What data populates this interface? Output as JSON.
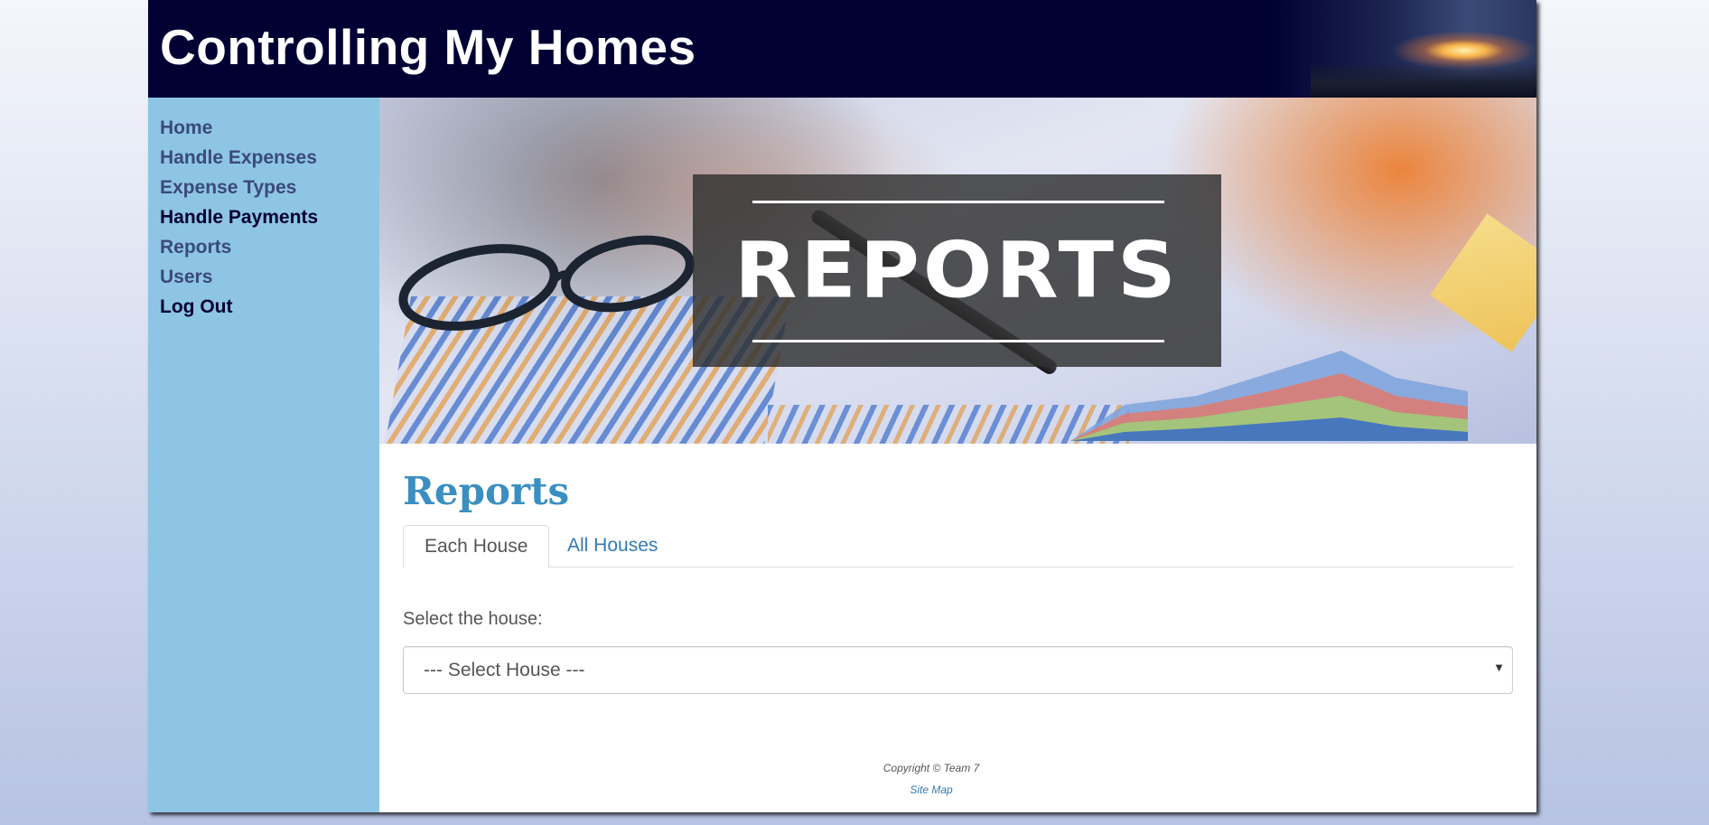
{
  "header": {
    "site_title": "Controlling My Homes"
  },
  "sidebar": {
    "items": [
      {
        "label": "Home"
      },
      {
        "label": "Handle Expenses"
      },
      {
        "label": "Expense Types"
      },
      {
        "label": "Handle Payments"
      },
      {
        "label": "Reports"
      },
      {
        "label": "Users"
      },
      {
        "label": "Log Out"
      }
    ]
  },
  "banner": {
    "text": "REPORTS"
  },
  "main": {
    "page_title": "Reports",
    "tabs": [
      {
        "label": "Each House",
        "active": true
      },
      {
        "label": "All Houses",
        "active": false
      }
    ],
    "select_label": "Select the house:",
    "select_value": "--- Select House ---"
  },
  "footer": {
    "copyright": "Copyright © Team 7",
    "sitemap": "Site Map"
  },
  "colors": {
    "header_bg": "#000033",
    "sidebar_bg": "#8ec5e4",
    "title_blue": "#3b8fc0",
    "link_blue": "#337ab7"
  }
}
